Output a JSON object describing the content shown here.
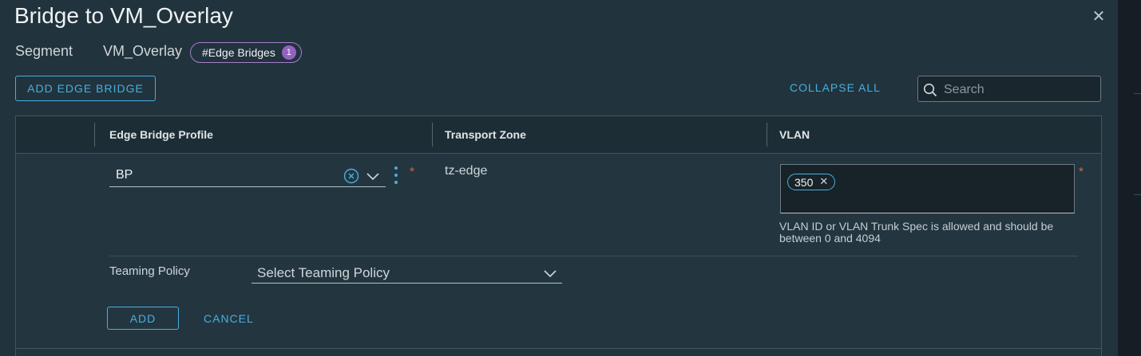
{
  "modal": {
    "title": "Bridge to VM_Overlay",
    "close_icon": "close-icon",
    "segment_label": "Segment",
    "segment_name": "VM_Overlay",
    "edge_bridges_pill": {
      "label": "#Edge Bridges",
      "count": "1"
    }
  },
  "toolbar": {
    "add_edge_bridge_label": "ADD EDGE BRIDGE",
    "collapse_all_label": "COLLAPSE ALL",
    "search_placeholder": "Search",
    "search_icon": "search-icon"
  },
  "grid": {
    "columns": [
      "Edge Bridge Profile",
      "Transport Zone",
      "VLAN"
    ],
    "row": {
      "edge_bridge_profile": "BP",
      "required_marker": "*",
      "transport_zone": "tz-edge",
      "vlan_chips": [
        "350"
      ],
      "vlan_help": "VLAN ID or VLAN Trunk Spec is allowed and should be between 0 and 4094",
      "teaming_policy_label": "Teaming Policy",
      "teaming_policy_placeholder": "Select Teaming Policy",
      "add_label": "ADD",
      "cancel_label": "CANCEL"
    }
  },
  "colors": {
    "accent": "#49aee0",
    "required": "#e0623f",
    "pill_border": "#a57fc9",
    "pill_badge": "#9461c1",
    "background": "#21333d"
  }
}
